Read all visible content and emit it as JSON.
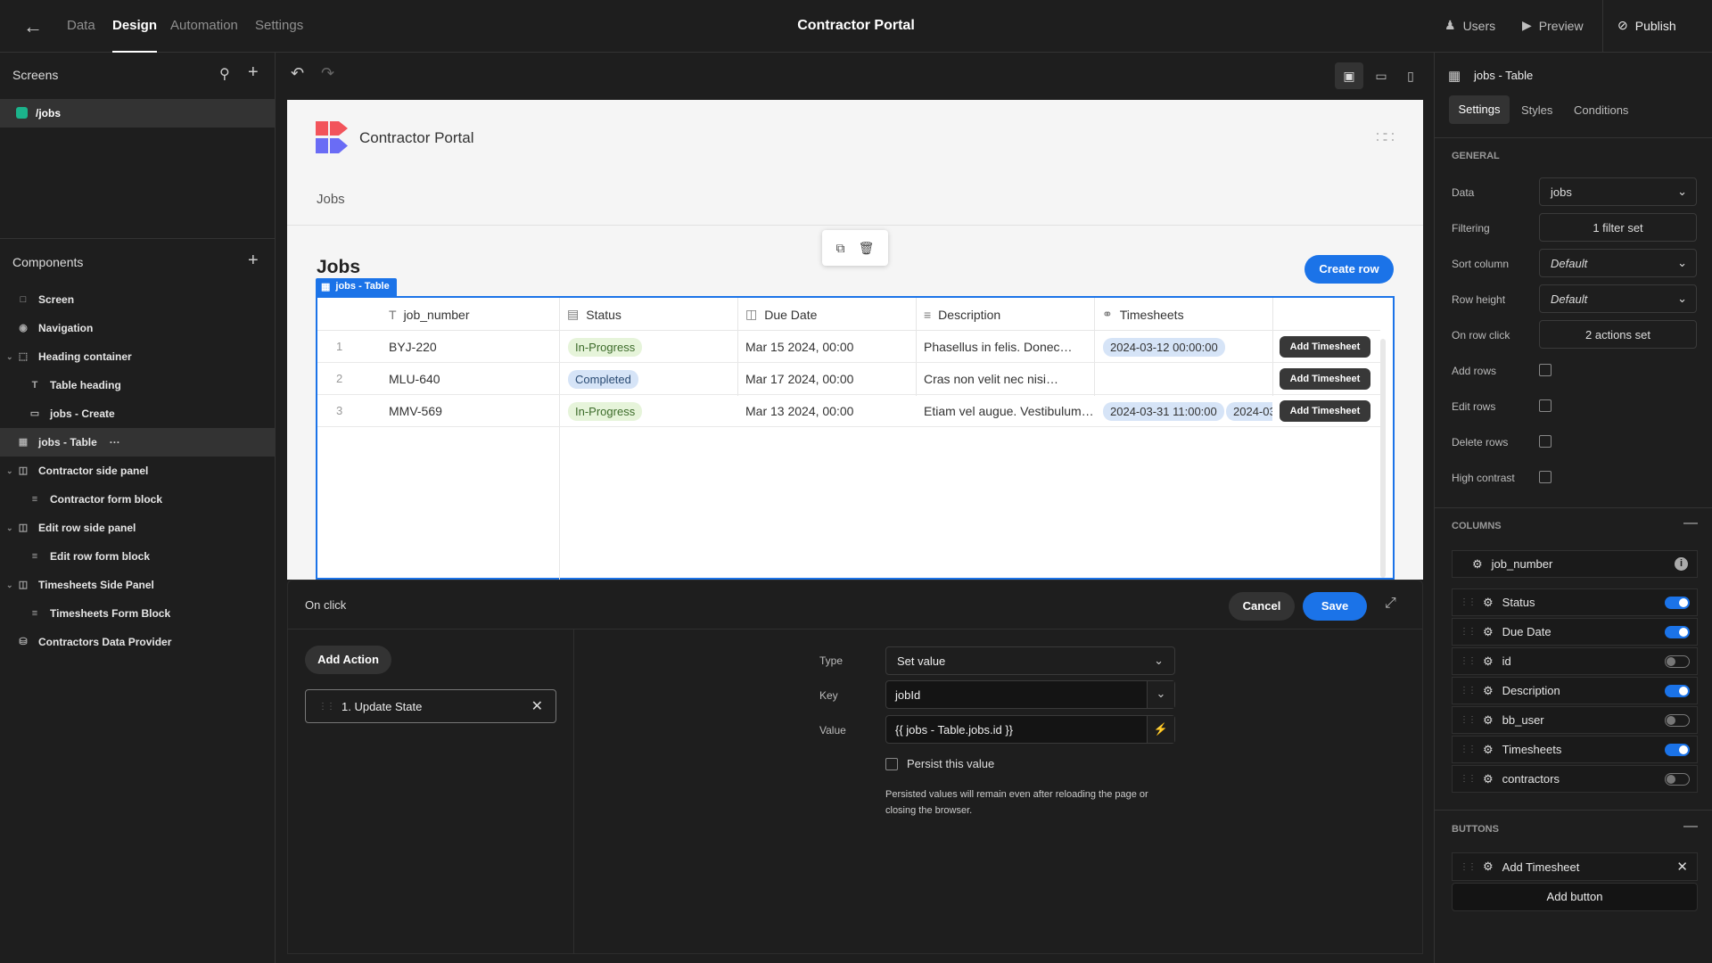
{
  "topbar": {
    "tabs": [
      "Data",
      "Design",
      "Automation",
      "Settings"
    ],
    "title": "Contractor Portal",
    "users": "Users",
    "preview": "Preview",
    "publish": "Publish"
  },
  "screens": {
    "title": "Screens",
    "items": [
      {
        "label": "/jobs",
        "color": "#1bb38b"
      }
    ]
  },
  "components": {
    "title": "Components",
    "items": [
      {
        "label": "Screen",
        "icon": "screen-icon"
      },
      {
        "label": "Navigation",
        "icon": "eye-icon"
      },
      {
        "label": "Heading container",
        "icon": "container-icon"
      },
      {
        "label": "Table heading",
        "icon": "text-icon"
      },
      {
        "label": "jobs - Create",
        "icon": "button-icon"
      },
      {
        "label": "jobs - Table",
        "icon": "table-icon",
        "more": "···"
      },
      {
        "label": "Contractor side panel",
        "icon": "panel-icon"
      },
      {
        "label": "Contractor form block",
        "icon": "form-icon"
      },
      {
        "label": "Edit row side panel",
        "icon": "panel-icon"
      },
      {
        "label": "Edit row form block",
        "icon": "form-icon"
      },
      {
        "label": "Timesheets Side Panel",
        "icon": "panel-icon"
      },
      {
        "label": "Timesheets Form Block",
        "icon": "form-icon"
      },
      {
        "label": "Contractors Data Provider",
        "icon": "database-icon"
      }
    ]
  },
  "canvas": {
    "app_name": "Contractor Portal",
    "nav_link": "Jobs",
    "heading": "Jobs",
    "create_button": "Create row",
    "table_badge": "jobs - Table",
    "columns": [
      "job_number",
      "Status",
      "Due Date",
      "Description",
      "Timesheets"
    ],
    "rows": [
      {
        "index": "1",
        "job_number": "BYJ-220",
        "status": "In-Progress",
        "due": "Mar 15 2024, 00:00",
        "description": "Phasellus in felis. Donec…",
        "timesheets": [
          "2024-03-12 00:00:00"
        ],
        "action": "Add Timesheet"
      },
      {
        "index": "2",
        "job_number": "MLU-640",
        "status": "Completed",
        "due": "Mar 17 2024, 00:00",
        "description": "Cras non velit nec nisi…",
        "timesheets": [],
        "action": "Add Timesheet"
      },
      {
        "index": "3",
        "job_number": "MMV-569",
        "status": "In-Progress",
        "due": "Mar 13 2024, 00:00",
        "description": "Etiam vel augue. Vestibulum…",
        "timesheets": [
          "2024-03-31 11:00:00",
          "2024-03"
        ],
        "action": "Add Timesheet"
      }
    ],
    "status_colors": {
      "In-Progress": "#e6f4da",
      "Completed": "#d6e4f7"
    }
  },
  "onclick": {
    "title": "On click",
    "cancel": "Cancel",
    "save": "Save",
    "add_action": "Add Action",
    "action_item": "1. Update State",
    "type_label": "Type",
    "type_value": "Set value",
    "key_label": "Key",
    "key_value": "jobId",
    "value_label": "Value",
    "value_value": "{{ jobs - Table.jobs.id }}",
    "persist_label": "Persist this value",
    "persist_note": "Persisted values will remain even after reloading the page or closing the browser."
  },
  "settings": {
    "component": "jobs - Table",
    "tabs": [
      "Settings",
      "Styles",
      "Conditions"
    ],
    "general": "GENERAL",
    "data_label": "Data",
    "data_value": "jobs",
    "filtering_label": "Filtering",
    "filtering_value": "1 filter set",
    "sort_label": "Sort column",
    "sort_value": "Default",
    "height_label": "Row height",
    "height_value": "Default",
    "rowclick_label": "On row click",
    "rowclick_value": "2 actions set",
    "add_rows": "Add rows",
    "edit_rows": "Edit rows",
    "delete_rows": "Delete rows",
    "high_contrast": "High contrast",
    "columns_title": "COLUMNS",
    "columns": [
      {
        "label": "job_number",
        "state": "info"
      },
      {
        "label": "Status",
        "state": "on"
      },
      {
        "label": "Due Date",
        "state": "on"
      },
      {
        "label": "id",
        "state": "off"
      },
      {
        "label": "Description",
        "state": "on"
      },
      {
        "label": "bb_user",
        "state": "off"
      },
      {
        "label": "Timesheets",
        "state": "on"
      },
      {
        "label": "contractors",
        "state": "off"
      }
    ],
    "buttons_title": "BUTTONS",
    "button_item": "Add Timesheet",
    "add_button": "Add button"
  }
}
